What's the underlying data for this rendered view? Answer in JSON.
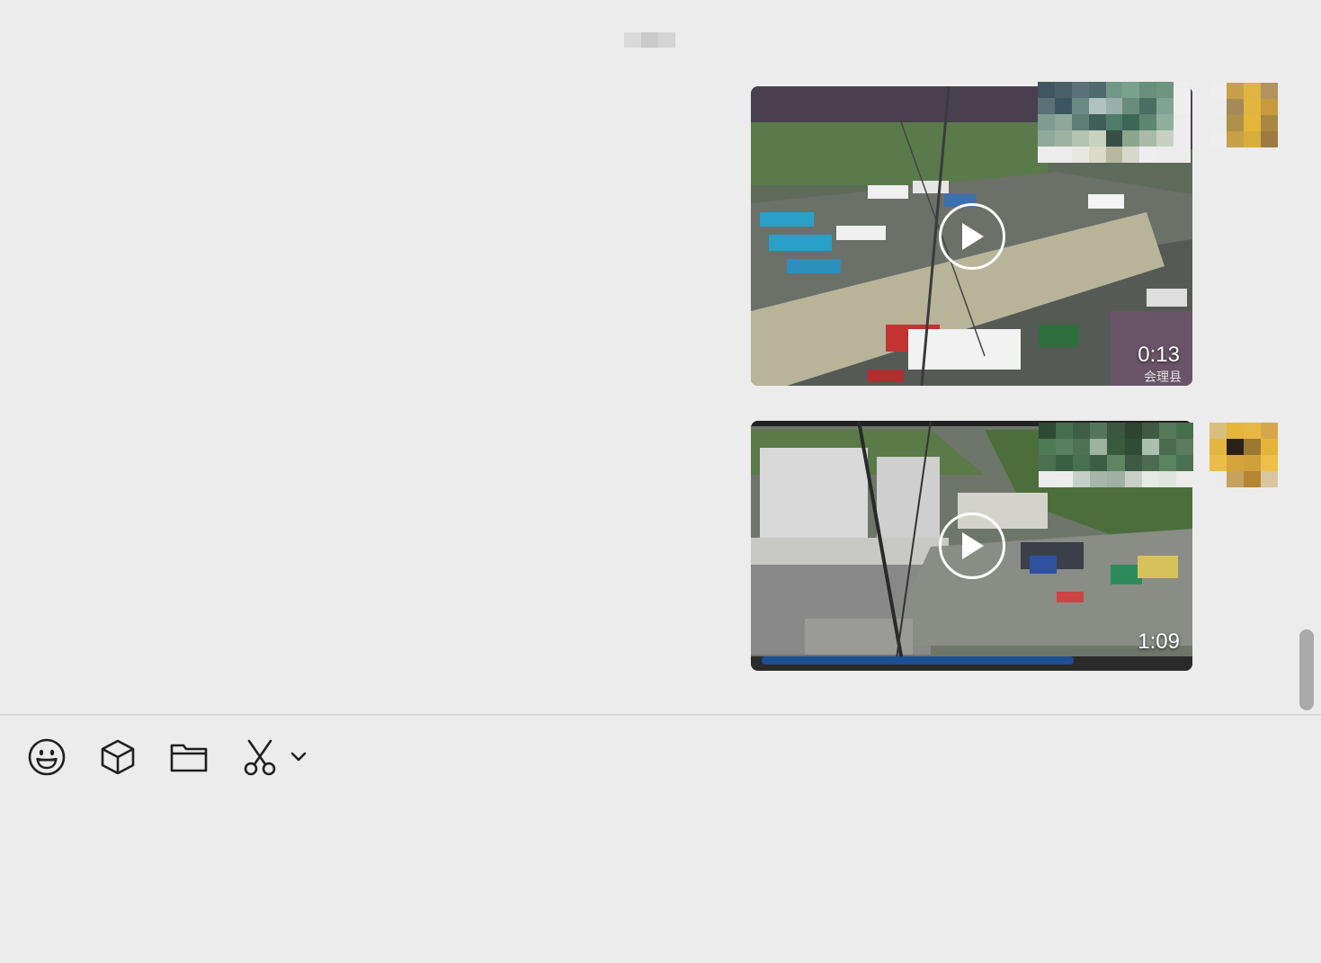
{
  "chat": {
    "messages": [
      {
        "type": "video",
        "duration": "0:13",
        "watermark": "会理县"
      },
      {
        "type": "video",
        "duration": "1:09"
      }
    ]
  },
  "toolbar": {
    "icons": [
      "emoji-icon",
      "sticker-icon",
      "folder-icon",
      "scissors-icon",
      "chevron-down-icon"
    ]
  },
  "composer": {
    "input_value": ""
  },
  "colors": {
    "background": "#ececec",
    "divider": "#d6d6d6",
    "scrollbar": "#aaaaaa",
    "icon": "#1f1f1f"
  }
}
